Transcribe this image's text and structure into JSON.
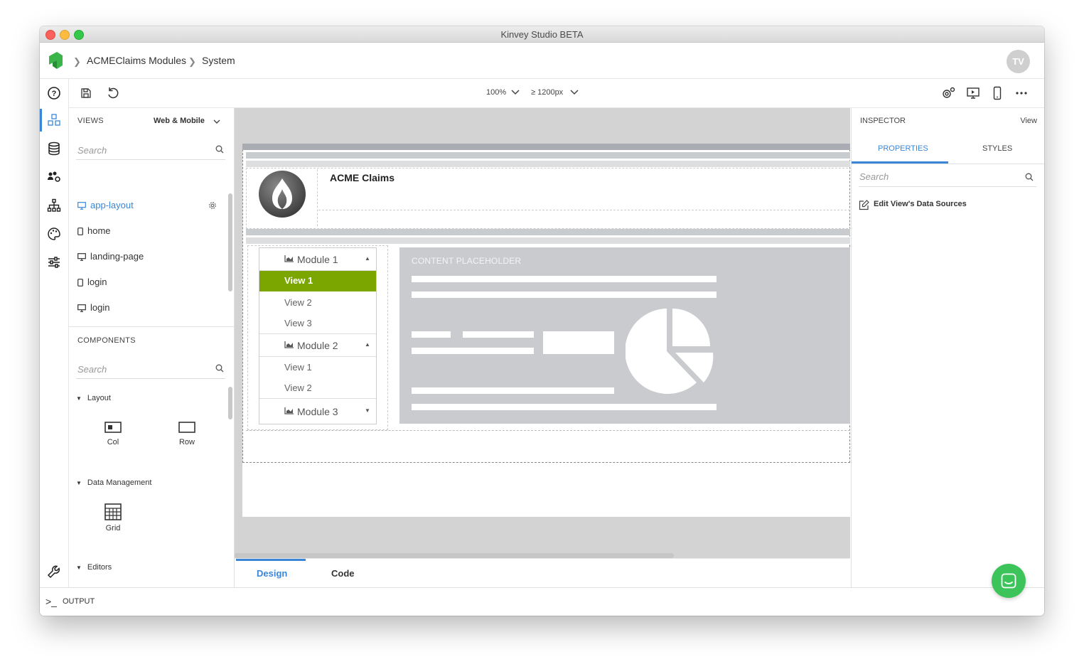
{
  "window": {
    "title": "Kinvey Studio BETA"
  },
  "breadcrumb": {
    "items": [
      "ACMEClaims Modules",
      "System"
    ]
  },
  "user": {
    "initials": "TV"
  },
  "toolbar": {
    "zoom": "100%",
    "breakpoint": "≥ 1200px"
  },
  "views_panel": {
    "title": "VIEWS",
    "filter": "Web & Mobile",
    "search_placeholder": "Search",
    "items": [
      {
        "label": "app-layout",
        "icon": "desktop-icon",
        "active": true
      },
      {
        "label": "home",
        "icon": "mobile-icon"
      },
      {
        "label": "landing-page",
        "icon": "desktop-icon"
      },
      {
        "label": "login",
        "icon": "mobile-icon"
      },
      {
        "label": "login",
        "icon": "desktop-icon"
      }
    ]
  },
  "components_panel": {
    "title": "COMPONENTS",
    "search_placeholder": "Search",
    "groups": [
      {
        "label": "Layout",
        "items": [
          "Col",
          "Row"
        ]
      },
      {
        "label": "Data Management",
        "items": [
          "Grid"
        ]
      },
      {
        "label": "Editors",
        "items": []
      }
    ]
  },
  "canvas": {
    "header_title": "ACME Claims",
    "content_placeholder": "CONTENT PLACEHOLDER",
    "nav": [
      {
        "module": "Module 1",
        "expanded": true,
        "views": [
          "View 1",
          "View 2",
          "View 3"
        ],
        "active_view": 0
      },
      {
        "module": "Module 2",
        "expanded": true,
        "views": [
          "View 1",
          "View 2"
        ]
      },
      {
        "module": "Module 3",
        "expanded": false,
        "views": []
      }
    ]
  },
  "editor_tabs": {
    "design": "Design",
    "code": "Code",
    "active": "Design"
  },
  "inspector": {
    "title": "INSPECTOR",
    "context": "View",
    "tabs": [
      "PROPERTIES",
      "STYLES"
    ],
    "active_tab": "PROPERTIES",
    "search_placeholder": "Search",
    "data_sources_link": "Edit View's Data Sources"
  },
  "output": {
    "label": "OUTPUT"
  },
  "colors": {
    "accent": "#3a87d8",
    "active_view": "#7ba600",
    "brand": "#3bb44a",
    "chat": "#3cc45a"
  }
}
